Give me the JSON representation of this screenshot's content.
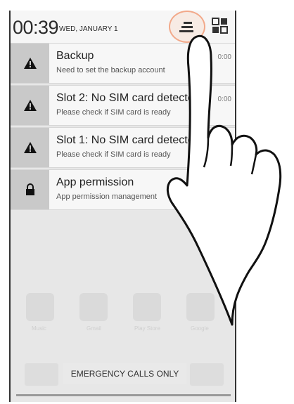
{
  "status_bar": {
    "time": "00:39",
    "date": "WED, JANUARY 1"
  },
  "notifications": [
    {
      "icon": "warning-icon",
      "title": "Backup",
      "description": "Need to set the backup account",
      "time": "0:00"
    },
    {
      "icon": "warning-icon",
      "title": "Slot 2: No SIM card detected",
      "description": "Please check if SIM card is ready",
      "time": "0:00"
    },
    {
      "icon": "warning-icon",
      "title": "Slot 1: No SIM card detected",
      "description": "Please check if SIM card is ready",
      "time": ""
    },
    {
      "icon": "lock-icon",
      "title": "App permission",
      "description": "App permission management",
      "time": ""
    }
  ],
  "background_apps": [
    "Music",
    "Gmail",
    "Play Store",
    "Google"
  ],
  "lockscreen": {
    "emergency_label": "EMERGENCY CALLS ONLY"
  },
  "colors": {
    "highlight_ring": "#f2a98a",
    "icon_box": "#c9c9c9",
    "notification_bg": "#f7f7f7"
  }
}
